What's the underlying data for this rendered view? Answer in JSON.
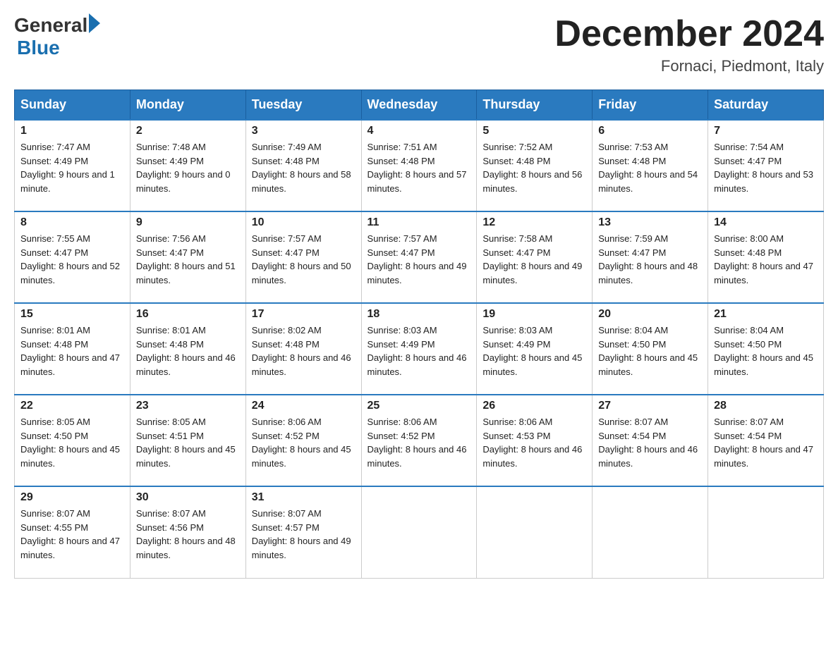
{
  "logo": {
    "general": "General",
    "blue": "Blue"
  },
  "header": {
    "title": "December 2024",
    "subtitle": "Fornaci, Piedmont, Italy"
  },
  "days_of_week": [
    "Sunday",
    "Monday",
    "Tuesday",
    "Wednesday",
    "Thursday",
    "Friday",
    "Saturday"
  ],
  "weeks": [
    [
      {
        "day": "1",
        "sunrise": "7:47 AM",
        "sunset": "4:49 PM",
        "daylight": "9 hours and 1 minute."
      },
      {
        "day": "2",
        "sunrise": "7:48 AM",
        "sunset": "4:49 PM",
        "daylight": "9 hours and 0 minutes."
      },
      {
        "day": "3",
        "sunrise": "7:49 AM",
        "sunset": "4:48 PM",
        "daylight": "8 hours and 58 minutes."
      },
      {
        "day": "4",
        "sunrise": "7:51 AM",
        "sunset": "4:48 PM",
        "daylight": "8 hours and 57 minutes."
      },
      {
        "day": "5",
        "sunrise": "7:52 AM",
        "sunset": "4:48 PM",
        "daylight": "8 hours and 56 minutes."
      },
      {
        "day": "6",
        "sunrise": "7:53 AM",
        "sunset": "4:48 PM",
        "daylight": "8 hours and 54 minutes."
      },
      {
        "day": "7",
        "sunrise": "7:54 AM",
        "sunset": "4:47 PM",
        "daylight": "8 hours and 53 minutes."
      }
    ],
    [
      {
        "day": "8",
        "sunrise": "7:55 AM",
        "sunset": "4:47 PM",
        "daylight": "8 hours and 52 minutes."
      },
      {
        "day": "9",
        "sunrise": "7:56 AM",
        "sunset": "4:47 PM",
        "daylight": "8 hours and 51 minutes."
      },
      {
        "day": "10",
        "sunrise": "7:57 AM",
        "sunset": "4:47 PM",
        "daylight": "8 hours and 50 minutes."
      },
      {
        "day": "11",
        "sunrise": "7:57 AM",
        "sunset": "4:47 PM",
        "daylight": "8 hours and 49 minutes."
      },
      {
        "day": "12",
        "sunrise": "7:58 AM",
        "sunset": "4:47 PM",
        "daylight": "8 hours and 49 minutes."
      },
      {
        "day": "13",
        "sunrise": "7:59 AM",
        "sunset": "4:47 PM",
        "daylight": "8 hours and 48 minutes."
      },
      {
        "day": "14",
        "sunrise": "8:00 AM",
        "sunset": "4:48 PM",
        "daylight": "8 hours and 47 minutes."
      }
    ],
    [
      {
        "day": "15",
        "sunrise": "8:01 AM",
        "sunset": "4:48 PM",
        "daylight": "8 hours and 47 minutes."
      },
      {
        "day": "16",
        "sunrise": "8:01 AM",
        "sunset": "4:48 PM",
        "daylight": "8 hours and 46 minutes."
      },
      {
        "day": "17",
        "sunrise": "8:02 AM",
        "sunset": "4:48 PM",
        "daylight": "8 hours and 46 minutes."
      },
      {
        "day": "18",
        "sunrise": "8:03 AM",
        "sunset": "4:49 PM",
        "daylight": "8 hours and 46 minutes."
      },
      {
        "day": "19",
        "sunrise": "8:03 AM",
        "sunset": "4:49 PM",
        "daylight": "8 hours and 45 minutes."
      },
      {
        "day": "20",
        "sunrise": "8:04 AM",
        "sunset": "4:50 PM",
        "daylight": "8 hours and 45 minutes."
      },
      {
        "day": "21",
        "sunrise": "8:04 AM",
        "sunset": "4:50 PM",
        "daylight": "8 hours and 45 minutes."
      }
    ],
    [
      {
        "day": "22",
        "sunrise": "8:05 AM",
        "sunset": "4:50 PM",
        "daylight": "8 hours and 45 minutes."
      },
      {
        "day": "23",
        "sunrise": "8:05 AM",
        "sunset": "4:51 PM",
        "daylight": "8 hours and 45 minutes."
      },
      {
        "day": "24",
        "sunrise": "8:06 AM",
        "sunset": "4:52 PM",
        "daylight": "8 hours and 45 minutes."
      },
      {
        "day": "25",
        "sunrise": "8:06 AM",
        "sunset": "4:52 PM",
        "daylight": "8 hours and 46 minutes."
      },
      {
        "day": "26",
        "sunrise": "8:06 AM",
        "sunset": "4:53 PM",
        "daylight": "8 hours and 46 minutes."
      },
      {
        "day": "27",
        "sunrise": "8:07 AM",
        "sunset": "4:54 PM",
        "daylight": "8 hours and 46 minutes."
      },
      {
        "day": "28",
        "sunrise": "8:07 AM",
        "sunset": "4:54 PM",
        "daylight": "8 hours and 47 minutes."
      }
    ],
    [
      {
        "day": "29",
        "sunrise": "8:07 AM",
        "sunset": "4:55 PM",
        "daylight": "8 hours and 47 minutes."
      },
      {
        "day": "30",
        "sunrise": "8:07 AM",
        "sunset": "4:56 PM",
        "daylight": "8 hours and 48 minutes."
      },
      {
        "day": "31",
        "sunrise": "8:07 AM",
        "sunset": "4:57 PM",
        "daylight": "8 hours and 49 minutes."
      },
      null,
      null,
      null,
      null
    ]
  ],
  "labels": {
    "sunrise": "Sunrise:",
    "sunset": "Sunset:",
    "daylight": "Daylight:"
  }
}
